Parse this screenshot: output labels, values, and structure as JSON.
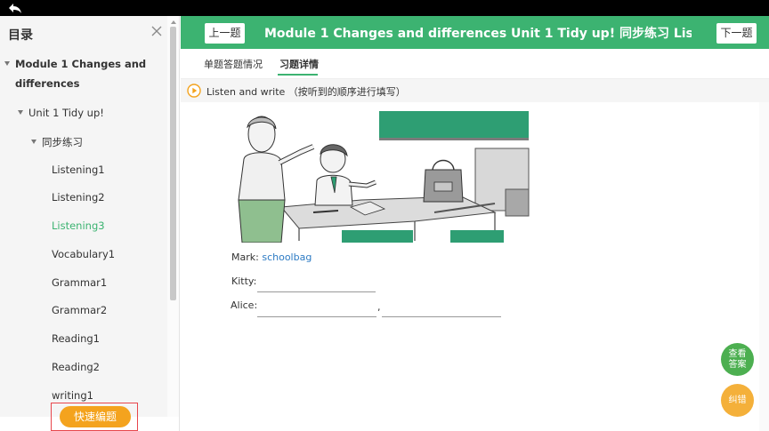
{
  "sidebar": {
    "title": "目录",
    "items": [
      {
        "label": "Module 1 Changes and",
        "label2": "differences"
      },
      {
        "label": "Unit 1 Tidy up!"
      },
      {
        "label": "同步练习"
      },
      {
        "label": "Listening1"
      },
      {
        "label": "Listening2"
      },
      {
        "label": "Listening3"
      },
      {
        "label": "Vocabulary1"
      },
      {
        "label": "Grammar1"
      },
      {
        "label": "Grammar2"
      },
      {
        "label": "Reading1"
      },
      {
        "label": "Reading2"
      },
      {
        "label": "writing1"
      }
    ],
    "quick_button": "快速编题"
  },
  "header": {
    "prev": "上一题",
    "next": "下一题",
    "title": "Module 1 Changes and differences Unit 1 Tidy up! 同步练习 Lis..."
  },
  "tabs": [
    "单题答题情况",
    "习题详情"
  ],
  "question": {
    "instruction": "Listen and write （按听到的顺序进行填写）"
  },
  "exercise": {
    "mark_label": "Mark:",
    "mark_answer": "schoolbag",
    "kitty_label": "Kitty:",
    "alice_label": "Alice:",
    "comma": ","
  },
  "fabs": {
    "answer": "查看答案",
    "fix": "纠错"
  },
  "colors": {
    "accent": "#3cb371",
    "orange": "#f4a31e",
    "answer_blue": "#2d7bc4",
    "highlight_red": "#e8464c"
  }
}
